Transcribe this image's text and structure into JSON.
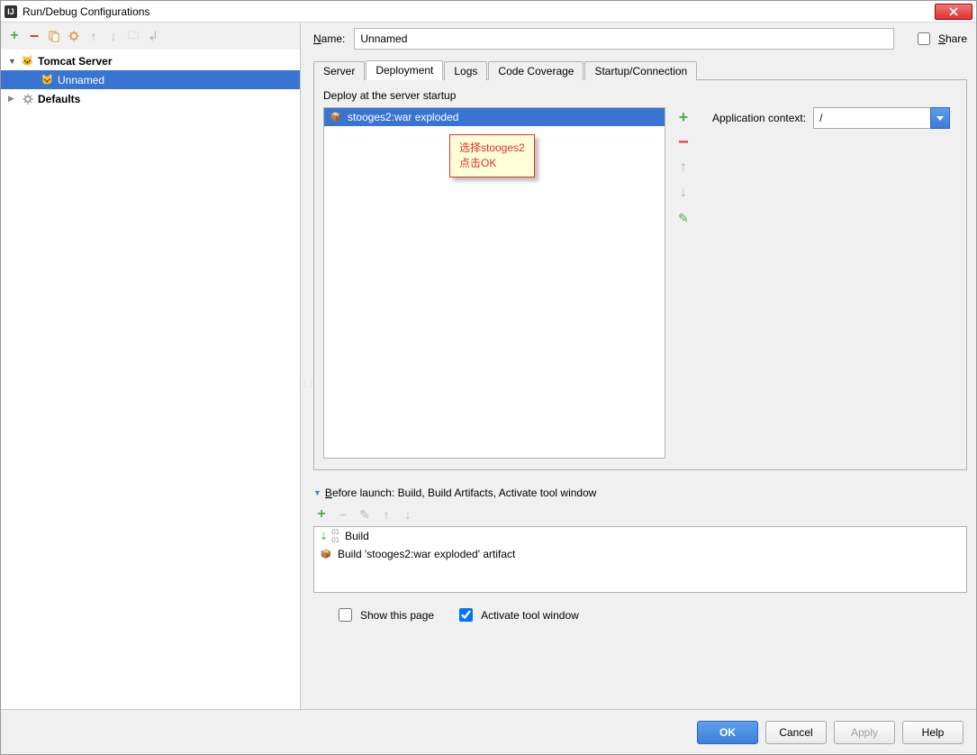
{
  "window": {
    "title": "Run/Debug Configurations"
  },
  "tree": {
    "root": "Tomcat Server",
    "selected": "Unnamed",
    "defaults": "Defaults"
  },
  "form": {
    "name_label": "Name:",
    "name_value": "Unnamed",
    "share_label": "Share"
  },
  "tabs": {
    "server": "Server",
    "deployment": "Deployment",
    "logs": "Logs",
    "code_coverage": "Code Coverage",
    "startup": "Startup/Connection"
  },
  "deployment": {
    "label": "Deploy at the server startup",
    "item": "stooges2:war exploded",
    "app_context_label": "Application context:",
    "app_context_value": "/"
  },
  "annotation": {
    "line1": "选择stooges2",
    "line2": "点击OK"
  },
  "before_launch": {
    "header": "Before launch: Build, Build Artifacts, Activate tool window",
    "item1": "Build",
    "item2": "Build 'stooges2:war exploded' artifact",
    "show_this_page": "Show this page",
    "activate_tool_window": "Activate tool window"
  },
  "buttons": {
    "ok": "OK",
    "cancel": "Cancel",
    "apply": "Apply",
    "help": "Help"
  }
}
